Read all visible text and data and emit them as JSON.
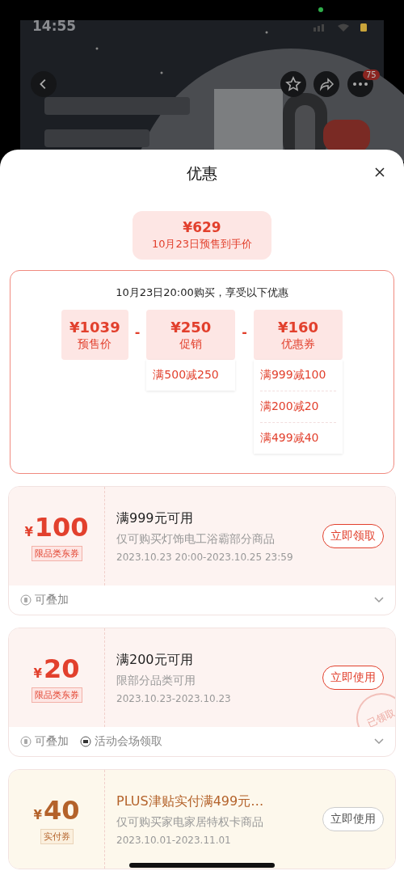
{
  "status_bar": {
    "time": "14:55"
  },
  "header": {
    "more_badge": "75"
  },
  "sheet": {
    "title": "优惠"
  },
  "final_price": {
    "amount": "¥629",
    "label": "10月23日预售到手价"
  },
  "breakdown": {
    "heading": "10月23日20:00购买，享受以下优惠",
    "items": [
      {
        "amount": "¥1039",
        "label": "预售价"
      },
      {
        "amount": "¥250",
        "label": "促销",
        "rules": [
          "满500减250"
        ]
      },
      {
        "amount": "¥160",
        "label": "优惠券",
        "rules": [
          "满999减100",
          "满200减20",
          "满499减40"
        ]
      }
    ],
    "operator": "-"
  },
  "coupons": [
    {
      "kind": "red",
      "currency": "¥",
      "amount": "100",
      "tag": "限品类东券",
      "title": "满999元可用",
      "desc": "仅可购买灯饰电工浴霸部分商品",
      "date": "2023.10.23 20:00-2023.10.25 23:59",
      "button": "立即领取",
      "footer": [
        {
          "kind": "stack",
          "text": "可叠加"
        }
      ]
    },
    {
      "kind": "red",
      "currency": "¥",
      "amount": "20",
      "tag": "限品类东券",
      "title": "满200元可用",
      "desc": "限部分品类可用",
      "date": "2023.10.23-2023.10.23",
      "button": "立即使用",
      "stamp": "已领取",
      "footer": [
        {
          "kind": "stack",
          "text": "可叠加"
        },
        {
          "kind": "venue",
          "text": "活动会场领取"
        }
      ]
    },
    {
      "kind": "gold",
      "currency": "¥",
      "amount": "40",
      "tag": "实付券",
      "title": "PLUS津贴实付满499元…",
      "desc": "仅可购买家电家居特权卡商品",
      "date": "2023.10.01-2023.11.01",
      "button": "立即使用"
    }
  ]
}
